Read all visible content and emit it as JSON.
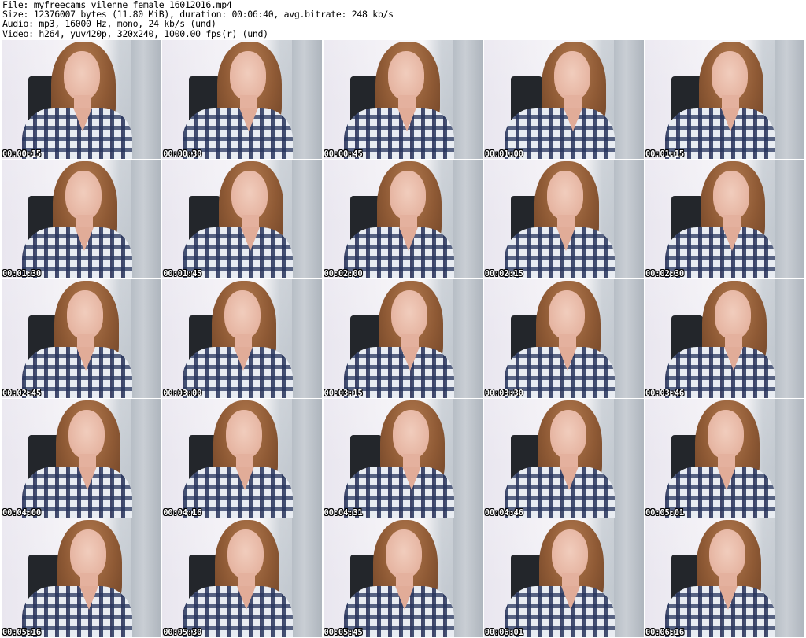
{
  "header": {
    "file_line": "File: myfreecams_vilenne_female_16012016.mp4",
    "size_line": "Size: 12376007 bytes (11.80 MiB), duration: 00:06:40, avg.bitrate: 248 kb/s",
    "audio_line": "Audio: mp3, 16000 Hz, mono, 24 kb/s (und)",
    "video_line": "Video: h264, yuv420p, 320x240, 1000.00 fps(r) (und)"
  },
  "thumbnails": [
    {
      "timestamp": "00:00:15"
    },
    {
      "timestamp": "00:00:30"
    },
    {
      "timestamp": "00:00:45"
    },
    {
      "timestamp": "00:01:00"
    },
    {
      "timestamp": "00:01:15"
    },
    {
      "timestamp": "00:01:30"
    },
    {
      "timestamp": "00:01:45"
    },
    {
      "timestamp": "00:02:00"
    },
    {
      "timestamp": "00:02:15"
    },
    {
      "timestamp": "00:02:30"
    },
    {
      "timestamp": "00:02:45"
    },
    {
      "timestamp": "00:03:00"
    },
    {
      "timestamp": "00:03:15"
    },
    {
      "timestamp": "00:03:30"
    },
    {
      "timestamp": "00:03:46"
    },
    {
      "timestamp": "00:04:00"
    },
    {
      "timestamp": "00:04:16"
    },
    {
      "timestamp": "00:04:31"
    },
    {
      "timestamp": "00:04:46"
    },
    {
      "timestamp": "00:05:01"
    },
    {
      "timestamp": "00:05:16"
    },
    {
      "timestamp": "00:05:30"
    },
    {
      "timestamp": "00:05:45"
    },
    {
      "timestamp": "00:06:01"
    },
    {
      "timestamp": "00:06:16"
    }
  ]
}
